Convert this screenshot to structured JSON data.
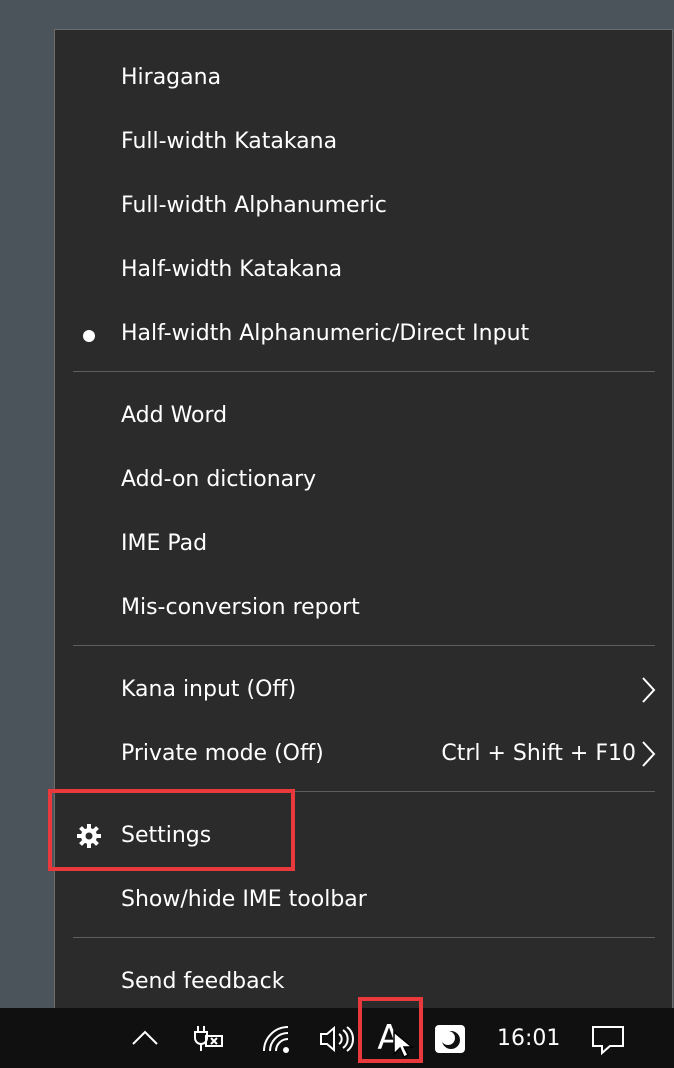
{
  "menu": {
    "input_modes": [
      {
        "label": "Hiragana",
        "selected": false
      },
      {
        "label": "Full-width Katakana",
        "selected": false
      },
      {
        "label": "Full-width Alphanumeric",
        "selected": false
      },
      {
        "label": "Half-width Katakana",
        "selected": false
      },
      {
        "label": "Half-width Alphanumeric/Direct Input",
        "selected": true
      }
    ],
    "tools": [
      {
        "label": "Add Word"
      },
      {
        "label": "Add-on dictionary"
      },
      {
        "label": "IME Pad"
      },
      {
        "label": "Mis-conversion report"
      }
    ],
    "options": [
      {
        "label": "Kana input (Off)",
        "has_submenu": true
      },
      {
        "label": "Private mode (Off)",
        "shortcut": "Ctrl + Shift + F10",
        "has_submenu": true
      }
    ],
    "settings_group": [
      {
        "label": "Settings",
        "icon": "gear-icon"
      },
      {
        "label": "Show/hide IME toolbar"
      }
    ],
    "feedback": {
      "label": "Send feedback"
    }
  },
  "taskbar": {
    "icons": [
      "chevron-up-icon",
      "power-plug-icon",
      "wifi-icon",
      "volume-icon",
      "ime-mode-icon",
      "app-tray-icon",
      "notification-icon"
    ],
    "ime_mode_char": "A",
    "clock": "16:01"
  },
  "colors": {
    "menu_bg": "#2b2b2b",
    "highlight": "#e9393c",
    "taskbar_bg": "#101010",
    "desktop": "#4b545b"
  }
}
